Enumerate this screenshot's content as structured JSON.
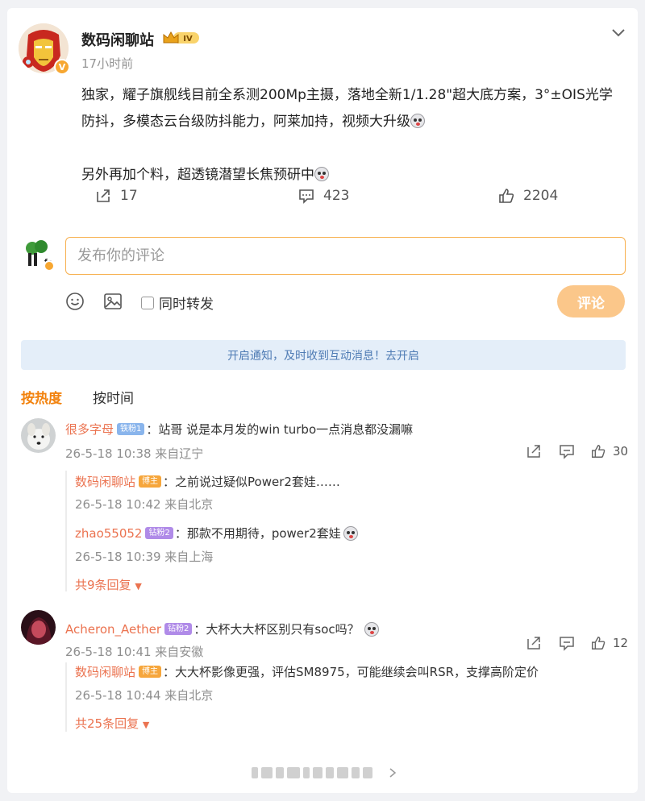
{
  "post": {
    "author": "数码闲聊站",
    "level_badge": "IV",
    "time": "17小时前",
    "paragraph1": "独家，耀子旗舰线目前全系测200Mp主摄，落地全新1/1.28\"超大底方案，3°±OIS光学防抖，多模态云台级防抖能力，阿莱加持，视频大升级",
    "paragraph2": "另外再加个料，超透镜潜望长焦预研中",
    "repost_count": "17",
    "comment_count": "423",
    "like_count": "2204"
  },
  "composer": {
    "placeholder": "发布你的评论",
    "repost_label": "同时转发",
    "submit_label": "评论"
  },
  "notice": "开启通知，及时收到互动消息！去开启",
  "sort": {
    "hot": "按热度",
    "time": "按时间"
  },
  "comments": [
    {
      "user": "很多字母",
      "badge": "铁粉1",
      "text": "：站哥 说是本月发的win turbo一点消息都没漏嘛",
      "meta": "26-5-18 10:38 来自辽宁",
      "likes": "30",
      "replies": [
        {
          "user": "数码闲聊站",
          "badge": "博主",
          "text": "：之前说过疑似Power2套娃……",
          "meta": "26-5-18 10:42 来自北京"
        },
        {
          "user": "zhao55052",
          "badge": "钻粉2",
          "text": "：那款不用期待，power2套娃",
          "meta": "26-5-18 10:39 来自上海"
        }
      ],
      "more": "共9条回复"
    },
    {
      "user": "Acheron_Aether",
      "badge": "钻粉2",
      "text": "：大杯大大杯区别只有soc吗？",
      "meta": "26-5-18 10:41 来自安徽",
      "likes": "12",
      "replies": [
        {
          "user": "数码闲聊站",
          "badge": "博主",
          "text": "：大大杯影像更强，评估SM8975，可能继续会叫RSR，支撑高阶定价",
          "meta": "26-5-18 10:44 来自北京"
        }
      ],
      "more": "共25条回复"
    }
  ],
  "colors": {
    "accent_orange": "#eb7350",
    "hot_sort": "#f2820d",
    "submit_bg": "#fbc78a",
    "notice_bg": "#e4eef9"
  }
}
